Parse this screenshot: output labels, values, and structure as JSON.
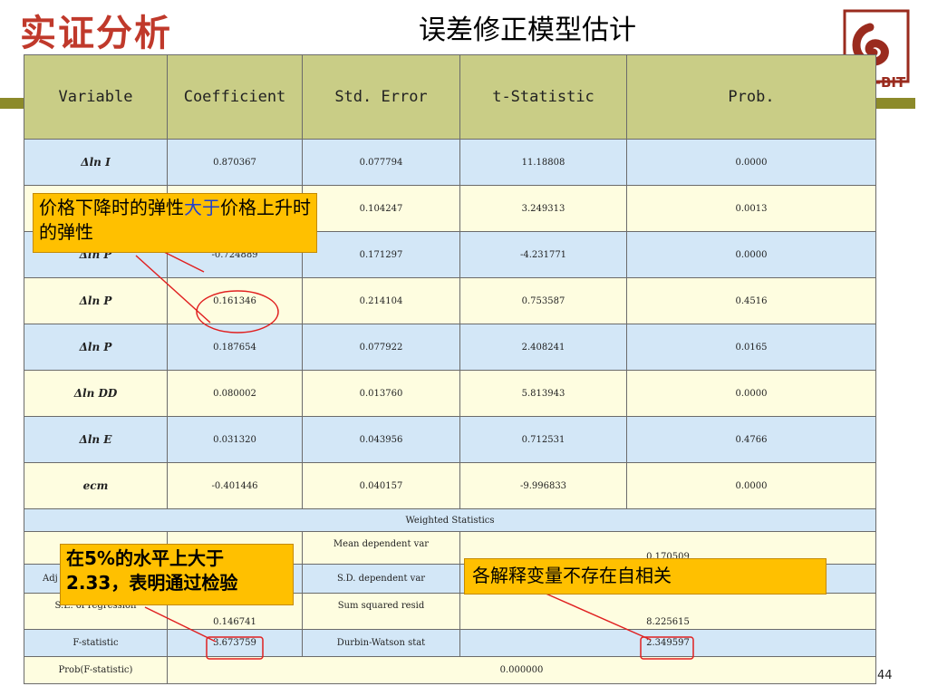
{
  "slide": {
    "section_title": "实证分析",
    "heading": "误差修正模型估计",
    "logo_text": "P-BIT",
    "page_number": "44"
  },
  "table": {
    "headers": [
      "Variable",
      "Coefficient",
      "Std. Error",
      "t-Statistic",
      "Prob."
    ],
    "rows": [
      {
        "variable": "Δln I",
        "coefficient": "0.870367",
        "std_error": "0.077794",
        "t_stat": "11.18808",
        "prob": "0.0000"
      },
      {
        "variable": "",
        "coefficient": "",
        "std_error": "0.104247",
        "t_stat": "3.249313",
        "prob": "0.0013"
      },
      {
        "variable": "Δln P",
        "coefficient": "-0.724889",
        "std_error": "0.171297",
        "t_stat": "-4.231771",
        "prob": "0.0000"
      },
      {
        "variable": "Δln P",
        "coefficient": "0.161346",
        "std_error": "0.214104",
        "t_stat": "0.753587",
        "prob": "0.4516"
      },
      {
        "variable": "Δln P",
        "coefficient": "0.187654",
        "std_error": "0.077922",
        "t_stat": "2.408241",
        "prob": "0.0165"
      },
      {
        "variable": "Δln DD",
        "coefficient": "0.080002",
        "std_error": "0.013760",
        "t_stat": "5.813943",
        "prob": "0.0000"
      },
      {
        "variable": "Δln E",
        "coefficient": "0.031320",
        "std_error": "0.043956",
        "t_stat": "0.712531",
        "prob": "0.4766"
      },
      {
        "variable": "ecm",
        "coefficient": "-0.401446",
        "std_error": "0.040157",
        "t_stat": "-9.996833",
        "prob": "0.0000"
      }
    ],
    "weighted_label": "Weighted Statistics",
    "stats": {
      "mean_dep_label": "Mean dependent var",
      "mean_dep_value": "0.170509",
      "adj_label": "Adj",
      "sd_dep_label": "S.D. dependent var",
      "se_reg_label": "S.E. of regression",
      "se_reg_value": "0.146741",
      "ssr_label": "Sum squared resid",
      "ssr_value": "8.225615",
      "f_label": "F-statistic",
      "f_value": "3.673759",
      "dw_label": "Durbin-Watson stat",
      "dw_value": "2.349597",
      "prob_f_label": "Prob(F-statistic)",
      "prob_f_value": "0.000000"
    }
  },
  "callouts": {
    "elasticity_part1": "价格下降时的弹性",
    "elasticity_highlight": "大于",
    "elasticity_part2": "价格上升时的弹性",
    "fstat_line1": "在5%的水平上大于",
    "fstat_line2": "2.33，表明通过检验",
    "dw": "各解释变量不存在自相关"
  },
  "colors": {
    "title_red": "#c0392b",
    "header_olive": "#c9cd86",
    "row_blue": "#d3e7f7",
    "row_yellow": "#fefde0",
    "callout_orange": "#ffc000",
    "circle_red": "#e02020"
  }
}
